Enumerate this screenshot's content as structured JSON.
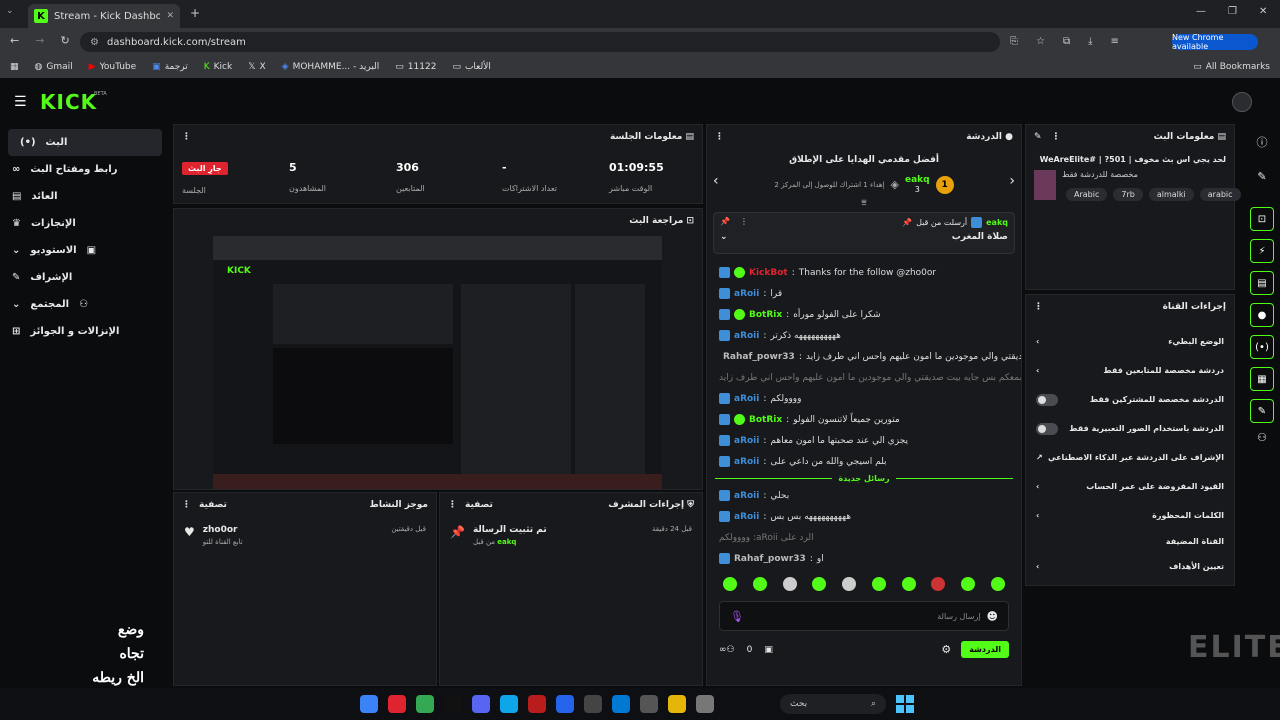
{
  "browser": {
    "tab_title": "Stream - Kick Dashboard",
    "url": "dashboard.kick.com/stream",
    "new_chrome": "New Chrome available",
    "bookmarks": [
      "Gmail",
      "YouTube",
      "ترجمة",
      "Kick",
      "X",
      "MOHAMME... - البريد",
      "11122",
      "الألعاب"
    ],
    "all_bookmarks": "All Bookmarks"
  },
  "logo": "KICK",
  "beta": "BETA",
  "nav": [
    "البث",
    "رابط ومفتاح البث",
    "العائد",
    "الإنجازات",
    "الاستوديو",
    "الإشراف",
    "المجتمع",
    "الإنزالات و الجوائز"
  ],
  "session": {
    "title": "معلومات الجلسة",
    "live_badge": "جارِ البث",
    "session_label": "الجلسة",
    "viewers": "5",
    "viewers_label": "المشاهدون",
    "followers": "306",
    "followers_label": "المتابعين",
    "subs": "-",
    "subs_label": "تعداد الاشتراكات",
    "uptime": "01:09:55",
    "uptime_label": "الوقت مباشر"
  },
  "preview": {
    "title": "مراجعة البث"
  },
  "activity": {
    "title": "موجز النشاط",
    "filter": "تصفية",
    "item_name": "zho0or",
    "item_sub": "تابع القناة للتو",
    "item_time": "قبل دقيقتين"
  },
  "modactions": {
    "title": "إجراءات المشرف",
    "filter": "تصفية",
    "item_title": "تم تثبيت الرسالة",
    "item_by": "من قبل",
    "item_user": "eakq",
    "item_time": "قبل 24 دقيقة"
  },
  "chat": {
    "title": "الدردشة",
    "gifts_title": "أفضل مقدمي الهدايا على الإطلاق",
    "gifter": "eakq",
    "gifter_count": "3",
    "gifter_rank": "1",
    "gift_next": "إهداء 1 اشتراك للوصول إلى المركز 2",
    "pinned_by": "أرسلت من قبل",
    "pinned_user": "eakq",
    "pinned_msg": "صلاة المغرب",
    "messages": [
      {
        "user": "KickBot",
        "text": "Thanks for the follow @zho0or",
        "color": "#e0242f"
      },
      {
        "user": "aRoii",
        "text": "قرا",
        "color": "#3f8ed8"
      },
      {
        "user": "BotRix",
        "text": "شكرا على الفولو مورأه",
        "color": "#53fc18"
      },
      {
        "user": "aRoii",
        "text": "ههههههههههه ذكرتر",
        "color": "#3f8ed8"
      },
      {
        "user": "Rahaf_powr33",
        "text": "هايي حاليا ما اسمعكم بس جايه بيت صديقتي والي موجودين ما امون عليهم واحس اني طرف زايد",
        "color": "#bbbbbb"
      },
      {
        "user": "",
        "text": "هايي حاليا ما اسمعكم بس جايه بيت صديقتي والي موجودين ما امون عليهم واحس اني طرف زايد",
        "color": "#777777"
      },
      {
        "user": "aRoii",
        "text": "وووولكم",
        "color": "#3f8ed8"
      },
      {
        "user": "BotRix",
        "text": "متورين جميعاً لاتنسون الفولو",
        "color": "#53fc18"
      },
      {
        "user": "aRoii",
        "text": "يجزي الي عند صحبتها ما امون معاهم",
        "color": "#3f8ed8"
      },
      {
        "user": "aRoii",
        "text": "بلم اسيجي والله من داعي على",
        "color": "#3f8ed8"
      }
    ],
    "new_messages": "رسائل جديدة",
    "messages2": [
      {
        "user": "aRoii",
        "text": "بحلي",
        "color": "#3f8ed8"
      },
      {
        "user": "aRoii",
        "text": "ههههههههههه بس بس",
        "color": "#3f8ed8"
      },
      {
        "user": "",
        "text": "الرد على aRoii: وووولكم",
        "color": "#777777"
      },
      {
        "user": "Rahaf_powr33",
        "text": "او",
        "color": "#bbbbbb"
      }
    ],
    "input_placeholder": "إرسال رسالة",
    "send": "الدردشة",
    "count": "0"
  },
  "info": {
    "title": "معلومات البث",
    "stream_title": "لحد يجي اس بث مخوف | WeAreElite# | ?501",
    "category": "مخصصة للدردشة فقط",
    "tags": [
      "Arabic",
      "7rb",
      "almalki",
      "arabic"
    ]
  },
  "channel_actions": {
    "title": "إجراءات القناة",
    "items": [
      "الوضع البطيء",
      "دردشة مخصصة للمتابعين فقط",
      "الدردشة مخصصة للمشتركين فقط",
      "الدردشة باستخدام الصور التعبيرية فقط",
      "الإشراف على الدردشة عبر الذكاء الاصطناعي",
      "القيود المفروضة على عمر الحساب",
      "الكلمات المحظورة",
      "القناة المضيفة",
      "تعيين الأهداف"
    ]
  },
  "overlay": {
    "lines": [
      "وضع",
      "تجاه",
      "الخ ريطه"
    ],
    "elite": "ELITE"
  },
  "taskbar": {
    "search": "بحث"
  },
  "colors": {
    "accent": "#53fc18",
    "live": "#e0242f",
    "panel": "#18191c"
  }
}
